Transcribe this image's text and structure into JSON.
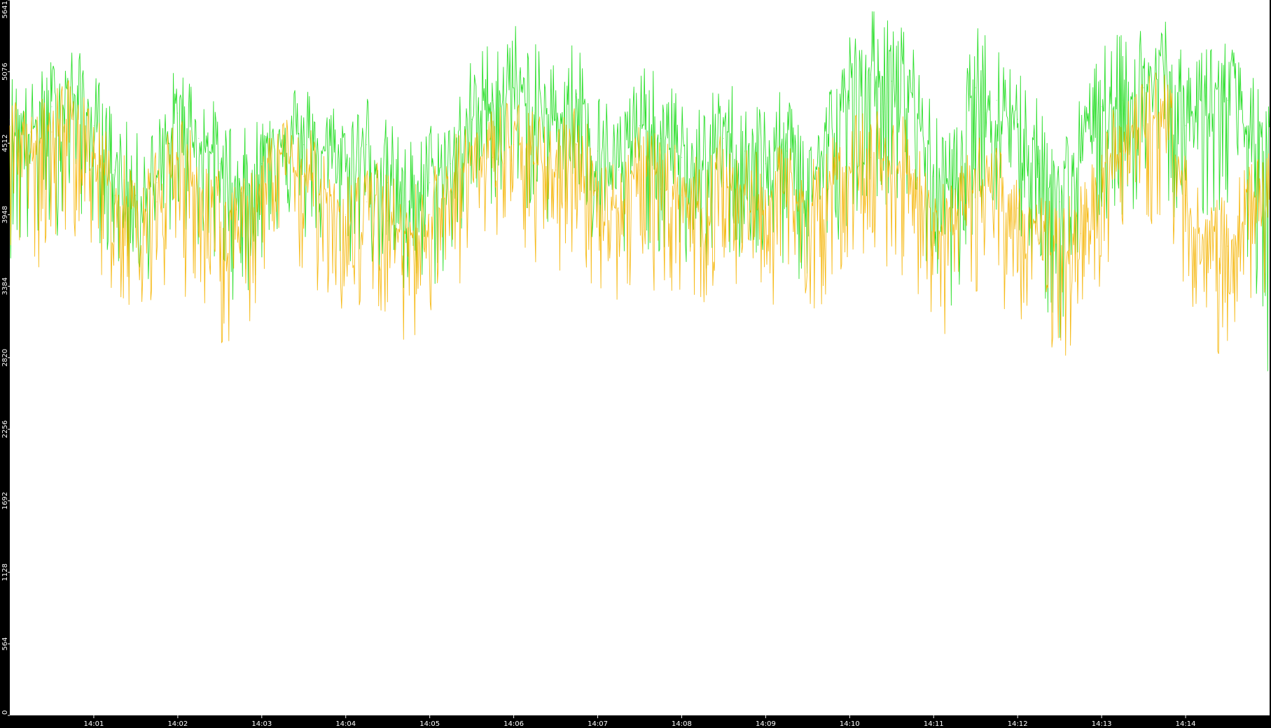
{
  "chart_data": {
    "type": "line",
    "title": "",
    "xlabel": "",
    "ylabel": "",
    "x_range": [
      "14:00:00",
      "14:15:00"
    ],
    "x_ticks": [
      "14:01",
      "14:02",
      "14:03",
      "14:04",
      "14:05",
      "14:06",
      "14:07",
      "14:08",
      "14:09",
      "14:10",
      "14:11",
      "14:12",
      "14:13",
      "14:14"
    ],
    "y_ticks": [
      0,
      564,
      1128,
      1692,
      2256,
      2820,
      3384,
      3948,
      4512,
      5076,
      5641
    ],
    "ylim": [
      0,
      5641
    ],
    "grid": false,
    "legend": "none",
    "colors": {
      "background": "#000000",
      "plot_area": "#ffffff",
      "series_green": "#22dd22",
      "series_orange": "#f5b400",
      "tick_text": "#ffffff"
    },
    "series": [
      {
        "color": "#22dd22",
        "x": [
          "14:00:00",
          "14:00:15",
          "14:00:30",
          "14:00:45",
          "14:01:00",
          "14:01:15",
          "14:01:30",
          "14:01:45",
          "14:02:00",
          "14:02:15",
          "14:02:30",
          "14:02:45",
          "14:03:00",
          "14:03:15",
          "14:03:30",
          "14:03:45",
          "14:04:00",
          "14:04:15",
          "14:04:30",
          "14:04:45",
          "14:05:00",
          "14:05:15",
          "14:05:30",
          "14:05:45",
          "14:06:00",
          "14:06:15",
          "14:06:30",
          "14:06:45",
          "14:07:00",
          "14:07:15",
          "14:07:30",
          "14:07:45",
          "14:08:00",
          "14:08:15",
          "14:08:30",
          "14:08:45",
          "14:09:00",
          "14:09:15",
          "14:09:30",
          "14:09:45",
          "14:10:00",
          "14:10:15",
          "14:10:30",
          "14:10:45",
          "14:11:00",
          "14:11:15",
          "14:11:30",
          "14:11:45",
          "14:12:00",
          "14:12:15",
          "14:12:30",
          "14:12:45",
          "14:13:00",
          "14:13:15",
          "14:13:30",
          "14:13:45",
          "14:14:00",
          "14:14:15",
          "14:14:30",
          "14:14:45",
          "14:15:00"
        ],
        "values": [
          4700,
          4600,
          4800,
          4900,
          4650,
          4300,
          4100,
          4200,
          4750,
          4550,
          4350,
          4100,
          4350,
          4650,
          4500,
          4450,
          4350,
          4500,
          4200,
          4050,
          4200,
          4350,
          4700,
          4850,
          4950,
          4750,
          4700,
          4900,
          4450,
          4300,
          4650,
          4550,
          4400,
          4300,
          4550,
          4450,
          4350,
          4450,
          4200,
          4500,
          4850,
          5050,
          5000,
          4900,
          4250,
          4150,
          4950,
          4850,
          4700,
          4350,
          4050,
          4400,
          4800,
          4850,
          4950,
          5050,
          4650,
          4950,
          4850,
          4600,
          4650
        ],
        "low": [
          3600,
          3500,
          3700,
          4000,
          3800,
          3500,
          3300,
          3500,
          3900,
          3600,
          3400,
          3200,
          3500,
          3900,
          3700,
          3600,
          3500,
          3600,
          3300,
          3100,
          3300,
          3500,
          3900,
          4000,
          4100,
          3900,
          3800,
          4000,
          3500,
          3400,
          3700,
          3600,
          3500,
          3400,
          3600,
          3500,
          3400,
          3500,
          3300,
          3600,
          3900,
          4100,
          4000,
          3900,
          3300,
          3200,
          3900,
          3800,
          3700,
          3300,
          2900,
          3400,
          3800,
          3900,
          4000,
          4100,
          3700,
          3900,
          3800,
          3600,
          2200
        ],
        "high": [
          5100,
          5000,
          5200,
          5300,
          5100,
          4800,
          4600,
          4700,
          5200,
          5000,
          4800,
          4600,
          4800,
          5100,
          5000,
          4900,
          4800,
          4950,
          4700,
          4550,
          4700,
          4800,
          5200,
          5400,
          5500,
          5300,
          5200,
          5400,
          4950,
          4800,
          5150,
          5050,
          4900,
          4800,
          5050,
          4950,
          4850,
          4950,
          4700,
          5000,
          5400,
          5600,
          5500,
          5400,
          4750,
          4650,
          5450,
          5350,
          5200,
          4850,
          4550,
          4900,
          5300,
          5400,
          5500,
          5600,
          5150,
          5450,
          5350,
          5100,
          4800
        ]
      },
      {
        "color": "#f5b400",
        "x": [
          "14:00:00",
          "14:00:15",
          "14:00:30",
          "14:00:45",
          "14:01:00",
          "14:01:15",
          "14:01:30",
          "14:01:45",
          "14:02:00",
          "14:02:15",
          "14:02:30",
          "14:02:45",
          "14:03:00",
          "14:03:15",
          "14:03:30",
          "14:03:45",
          "14:04:00",
          "14:04:15",
          "14:04:30",
          "14:04:45",
          "14:05:00",
          "14:05:15",
          "14:05:30",
          "14:05:45",
          "14:06:00",
          "14:06:15",
          "14:06:30",
          "14:06:45",
          "14:07:00",
          "14:07:15",
          "14:07:30",
          "14:07:45",
          "14:08:00",
          "14:08:15",
          "14:08:30",
          "14:08:45",
          "14:09:00",
          "14:09:15",
          "14:09:30",
          "14:09:45",
          "14:10:00",
          "14:10:15",
          "14:10:30",
          "14:10:45",
          "14:11:00",
          "14:11:15",
          "14:11:30",
          "14:11:45",
          "14:12:00",
          "14:12:15",
          "14:12:30",
          "14:12:45",
          "14:13:00",
          "14:13:15",
          "14:13:30",
          "14:13:45",
          "14:14:00",
          "14:14:15",
          "14:14:30",
          "14:14:45",
          "14:15:00"
        ],
        "values": [
          4500,
          4350,
          4600,
          4700,
          4400,
          4100,
          3950,
          4050,
          4400,
          4150,
          3850,
          3700,
          4150,
          4350,
          4250,
          4150,
          3950,
          4050,
          3900,
          3750,
          3950,
          4150,
          4350,
          4400,
          4500,
          4350,
          4300,
          4500,
          4100,
          4000,
          4300,
          4150,
          4100,
          4000,
          4200,
          4100,
          4000,
          4150,
          3950,
          4150,
          4350,
          4400,
          4350,
          4300,
          3850,
          3800,
          4200,
          4100,
          4000,
          3750,
          3550,
          3800,
          4300,
          4450,
          4650,
          4750,
          4100,
          3450,
          3700,
          3950,
          4050
        ],
        "low": [
          3500,
          3400,
          3600,
          3800,
          3500,
          3300,
          3200,
          3300,
          3400,
          3100,
          2900,
          2850,
          3300,
          3500,
          3400,
          3300,
          3100,
          3200,
          3000,
          2950,
          3100,
          3300,
          3500,
          3600,
          3700,
          3500,
          3400,
          3600,
          3300,
          3150,
          3450,
          3300,
          3300,
          3200,
          3400,
          3300,
          3200,
          3300,
          3100,
          3300,
          3500,
          3600,
          3500,
          3400,
          3000,
          2950,
          3300,
          3200,
          3150,
          2950,
          2750,
          3000,
          3400,
          3600,
          3800,
          3900,
          3300,
          2600,
          2950,
          3200,
          3300
        ],
        "high": [
          4900,
          4750,
          5000,
          5050,
          4800,
          4500,
          4350,
          4450,
          4800,
          4550,
          4300,
          4200,
          4550,
          4750,
          4650,
          4550,
          4350,
          4450,
          4300,
          4150,
          4350,
          4550,
          4750,
          4800,
          4950,
          4750,
          4700,
          4900,
          4500,
          4400,
          4700,
          4550,
          4500,
          4400,
          4600,
          4500,
          4400,
          4550,
          4350,
          4550,
          4750,
          4850,
          4750,
          4700,
          4250,
          4200,
          4600,
          4500,
          4400,
          4150,
          4000,
          4250,
          4700,
          4850,
          5050,
          5150,
          4500,
          4000,
          4150,
          4350,
          4450
        ]
      }
    ]
  }
}
